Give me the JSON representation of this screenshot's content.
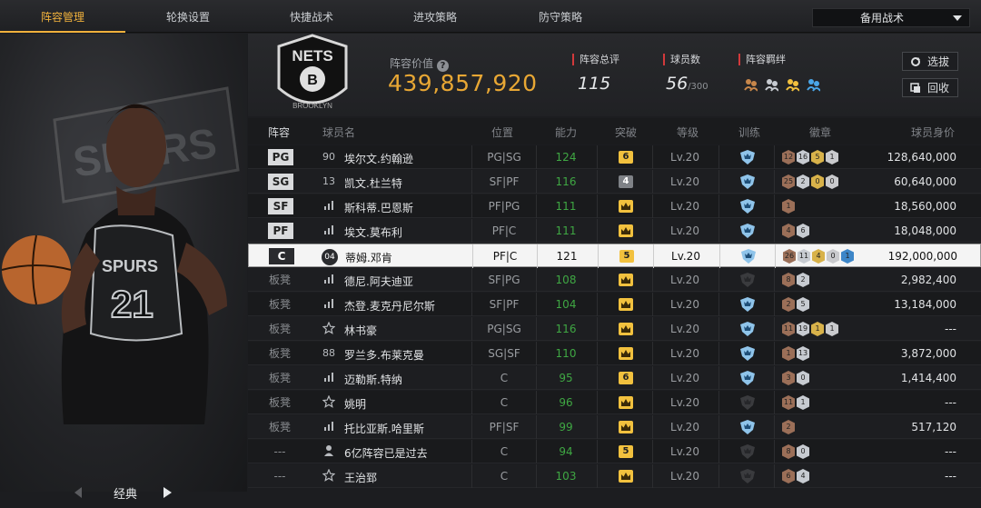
{
  "tabs": [
    "阵容管理",
    "轮换设置",
    "快捷战术",
    "进攻策略",
    "防守策略"
  ],
  "active_tab": 0,
  "tactics_dropdown": "备用战术",
  "variant": {
    "label": "经典"
  },
  "team": {
    "logo_text": "NETS",
    "logo_subtext": "BROOKLYN"
  },
  "lineup_value": {
    "label": "阵容价值",
    "value": "439,857,920"
  },
  "stats": {
    "total_rating_label": "阵容总评",
    "total_rating": "115",
    "players_label": "球员数",
    "players": "56",
    "players_max": "/300",
    "bonds_label": "阵容羁绊"
  },
  "buttons": {
    "select": "选拔",
    "recycle": "回收"
  },
  "columns": [
    "阵容",
    "球员名",
    "位置",
    "能力",
    "突破",
    "等级",
    "训练",
    "徽章",
    "球员身价"
  ],
  "colors": {
    "accent": "#f0b13c",
    "value": "#e8a734",
    "green": "#3fa743",
    "badge_gold": "#f2c13e"
  },
  "rows": [
    {
      "slot": "PG",
      "icon": "90",
      "name": "埃尔文.约翰逊",
      "pos": "PG|SG",
      "ovr": "124",
      "brk": "6",
      "lvl": "Lv.20",
      "train": true,
      "badges": [
        "12",
        "16",
        "5",
        "1"
      ],
      "worth": "128,640,000"
    },
    {
      "slot": "SG",
      "icon": "13",
      "name": "凯文.杜兰特",
      "pos": "SF|PF",
      "ovr": "116",
      "brk": "4",
      "lvl": "Lv.20",
      "train": true,
      "badges": [
        "25",
        "2",
        "0",
        "0"
      ],
      "worth": "60,640,000"
    },
    {
      "slot": "SF",
      "icon": "bars",
      "name": "斯科蒂.巴恩斯",
      "pos": "PF|PG",
      "ovr": "111",
      "brk": "crown",
      "lvl": "Lv.20",
      "train": true,
      "badges": [
        "1"
      ],
      "worth": "18,560,000"
    },
    {
      "slot": "PF",
      "icon": "bars",
      "name": "埃文.莫布利",
      "pos": "PF|C",
      "ovr": "111",
      "brk": "crown",
      "lvl": "Lv.20",
      "train": true,
      "badges": [
        "4",
        "6"
      ],
      "worth": "18,048,000"
    },
    {
      "slot": "C",
      "icon": "04",
      "name": "蒂姆.邓肯",
      "pos": "PF|C",
      "ovr": "121",
      "brk": "5",
      "lvl": "Lv.20",
      "train": true,
      "badges": [
        "26",
        "11",
        "4",
        "0",
        "1"
      ],
      "worth": "192,000,000",
      "selected": true
    },
    {
      "slot": "板凳",
      "icon": "bars",
      "name": "德尼.阿夫迪亚",
      "pos": "SF|PG",
      "ovr": "108",
      "brk": "crown",
      "lvl": "Lv.20",
      "train": false,
      "badges": [
        "8",
        "2"
      ],
      "worth": "2,982,400"
    },
    {
      "slot": "板凳",
      "icon": "bars",
      "name": "杰登.麦克丹尼尔斯",
      "pos": "SF|PF",
      "ovr": "104",
      "brk": "crown",
      "lvl": "Lv.20",
      "train": true,
      "badges": [
        "2",
        "5"
      ],
      "worth": "13,184,000"
    },
    {
      "slot": "板凳",
      "icon": "star",
      "name": "林书豪",
      "pos": "PG|SG",
      "ovr": "116",
      "brk": "crown",
      "lvl": "Lv.20",
      "train": true,
      "badges": [
        "11",
        "19",
        "1",
        "1"
      ],
      "worth": "---"
    },
    {
      "slot": "板凳",
      "icon": "88",
      "name": "罗兰多.布莱克曼",
      "pos": "SG|SF",
      "ovr": "110",
      "brk": "crown",
      "lvl": "Lv.20",
      "train": true,
      "badges": [
        "1",
        "13"
      ],
      "worth": "3,872,000"
    },
    {
      "slot": "板凳",
      "icon": "bars",
      "name": "迈勒斯.特纳",
      "pos": "C",
      "ovr": "95",
      "brk": "6",
      "lvl": "Lv.20",
      "train": true,
      "badges": [
        "3",
        "0"
      ],
      "worth": "1,414,400"
    },
    {
      "slot": "板凳",
      "icon": "star",
      "name": "姚明",
      "pos": "C",
      "ovr": "96",
      "brk": "crown",
      "lvl": "Lv.20",
      "train": false,
      "badges": [
        "11",
        "1"
      ],
      "worth": "---"
    },
    {
      "slot": "板凳",
      "icon": "bars",
      "name": "托比亚斯.哈里斯",
      "pos": "PF|SF",
      "ovr": "99",
      "brk": "crown",
      "lvl": "Lv.20",
      "train": true,
      "badges": [
        "2"
      ],
      "worth": "517,120"
    },
    {
      "slot": "---",
      "icon": "person",
      "name": "6亿阵容已是过去",
      "pos": "C",
      "ovr": "94",
      "brk": "5",
      "lvl": "Lv.20",
      "train": false,
      "badges": [
        "8",
        "0"
      ],
      "worth": "---"
    },
    {
      "slot": "---",
      "icon": "star",
      "name": "王治郅",
      "pos": "C",
      "ovr": "103",
      "brk": "crown",
      "lvl": "Lv.20",
      "train": false,
      "badges": [
        "6",
        "4"
      ],
      "worth": "---"
    }
  ]
}
